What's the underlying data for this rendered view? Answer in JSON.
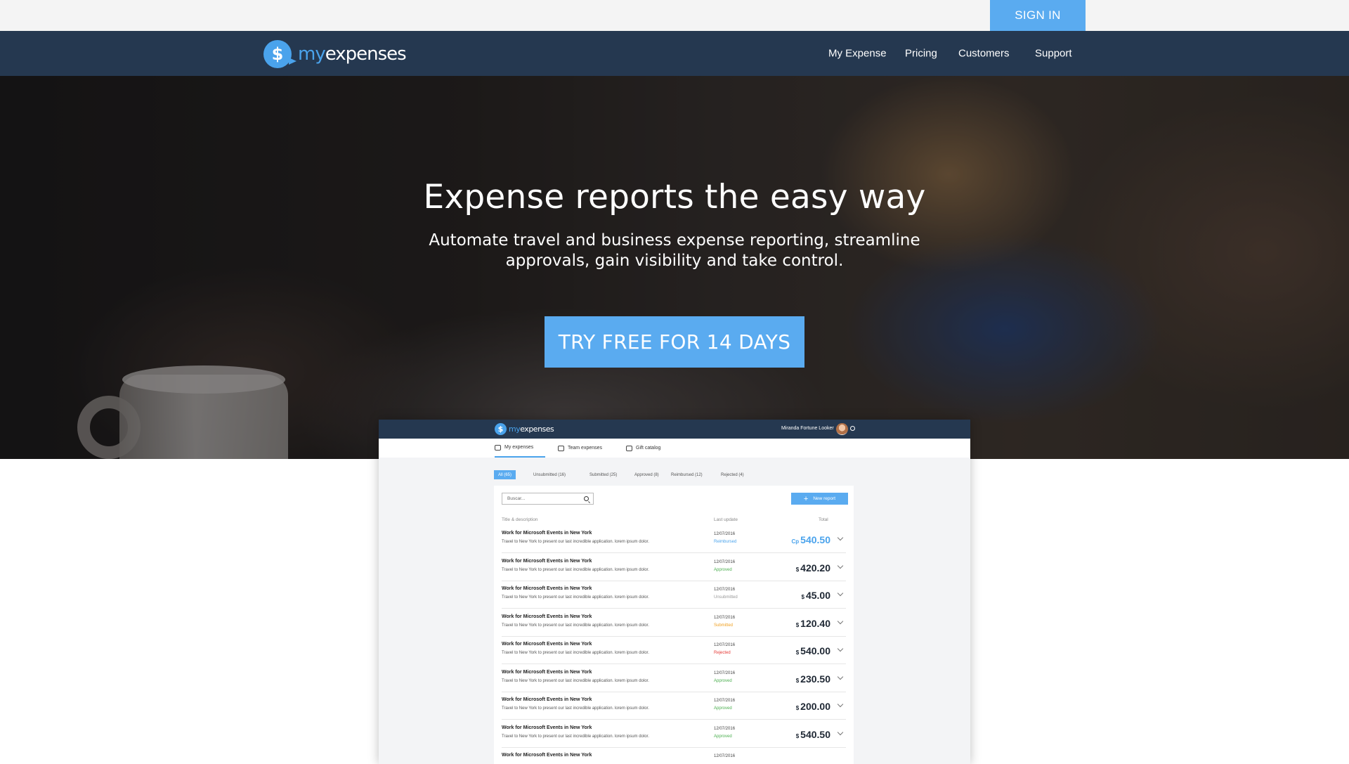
{
  "topbar": {
    "signin_label": "SIGN IN"
  },
  "nav": {
    "brand": {
      "prefix": "my",
      "suffix": "expenses",
      "symbol": "$"
    },
    "links": [
      "My Expense",
      "Pricing",
      "Customers",
      "Support"
    ]
  },
  "hero": {
    "title": "Expense reports the easy way",
    "subtitle": "Automate travel and business expense reporting, streamline approvals, gain visibility and take control.",
    "cta_label": "TRY FREE FOR 14 DAYS"
  },
  "app_preview": {
    "brand": {
      "prefix": "my",
      "suffix": "expenses",
      "symbol": "$"
    },
    "user_name": "Miranda Fortune Looker",
    "tabs": [
      "My expenses",
      "Team expenses",
      "Gift catalog"
    ],
    "filters": [
      "All (65)",
      "Unsubmitted (16)",
      "Submitted (25)",
      "Approved (8)",
      "Reimbursed (12)",
      "Rejected (4)"
    ],
    "search_placeholder": "Buscar...",
    "new_report_label": "New report",
    "columns": {
      "title": "Title & description",
      "last_update": "Last update",
      "total": "Total"
    },
    "rows": [
      {
        "title": "Work for Microsoft Events in New York",
        "description": "Travel to New York to present our last incredible application. lorem ipsum dolor.",
        "date": "12/07/2016",
        "status": "Reimbursed",
        "currency": "Cp",
        "amount": "540.50"
      },
      {
        "title": "Work for Microsoft Events in New York",
        "description": "Travel to New York to present our last incredible application. lorem ipsum dolor.",
        "date": "12/07/2016",
        "status": "Approved",
        "currency": "$",
        "amount": "420.20"
      },
      {
        "title": "Work for Microsoft Events in New York",
        "description": "Travel to New York to present our last incredible application. lorem ipsum dolor.",
        "date": "12/07/2016",
        "status": "Unsubmitted",
        "currency": "$",
        "amount": "45.00"
      },
      {
        "title": "Work for Microsoft Events in New York",
        "description": "Travel to New York to present our last incredible application. lorem ipsum dolor.",
        "date": "12/07/2016",
        "status": "Submitted",
        "currency": "$",
        "amount": "120.40"
      },
      {
        "title": "Work for Microsoft Events in New York",
        "description": "Travel to New York to present our last incredible application. lorem ipsum dolor.",
        "date": "12/07/2016",
        "status": "Rejected",
        "currency": "$",
        "amount": "540.00"
      },
      {
        "title": "Work for Microsoft Events in New York",
        "description": "Travel to New York to present our last incredible application. lorem ipsum dolor.",
        "date": "12/07/2016",
        "status": "Approved",
        "currency": "$",
        "amount": "230.50"
      },
      {
        "title": "Work for Microsoft Events in New York",
        "description": "Travel to New York to present our last incredible application. lorem ipsum dolor.",
        "date": "12/07/2016",
        "status": "Approved",
        "currency": "$",
        "amount": "200.00"
      },
      {
        "title": "Work for Microsoft Events in New York",
        "description": "Travel to New York to present our last incredible application. lorem ipsum dolor.",
        "date": "12/07/2016",
        "status": "Approved",
        "currency": "$",
        "amount": "540.50"
      },
      {
        "title": "Work for Microsoft Events in New York",
        "description": "",
        "date": "12/07/2016",
        "status": "",
        "currency": "",
        "amount": ""
      }
    ],
    "status_colors": {
      "Reimbursed": "#4aa3ec",
      "Approved": "#4caf50",
      "Unsubmitted": "#999999",
      "Submitted": "#f0a020",
      "Rejected": "#e53935"
    }
  },
  "colors": {
    "accent": "#5aabf0",
    "navbar": "#253850",
    "topbar": "#f4f4f4",
    "highlight_amount": "#4aa3ec"
  }
}
